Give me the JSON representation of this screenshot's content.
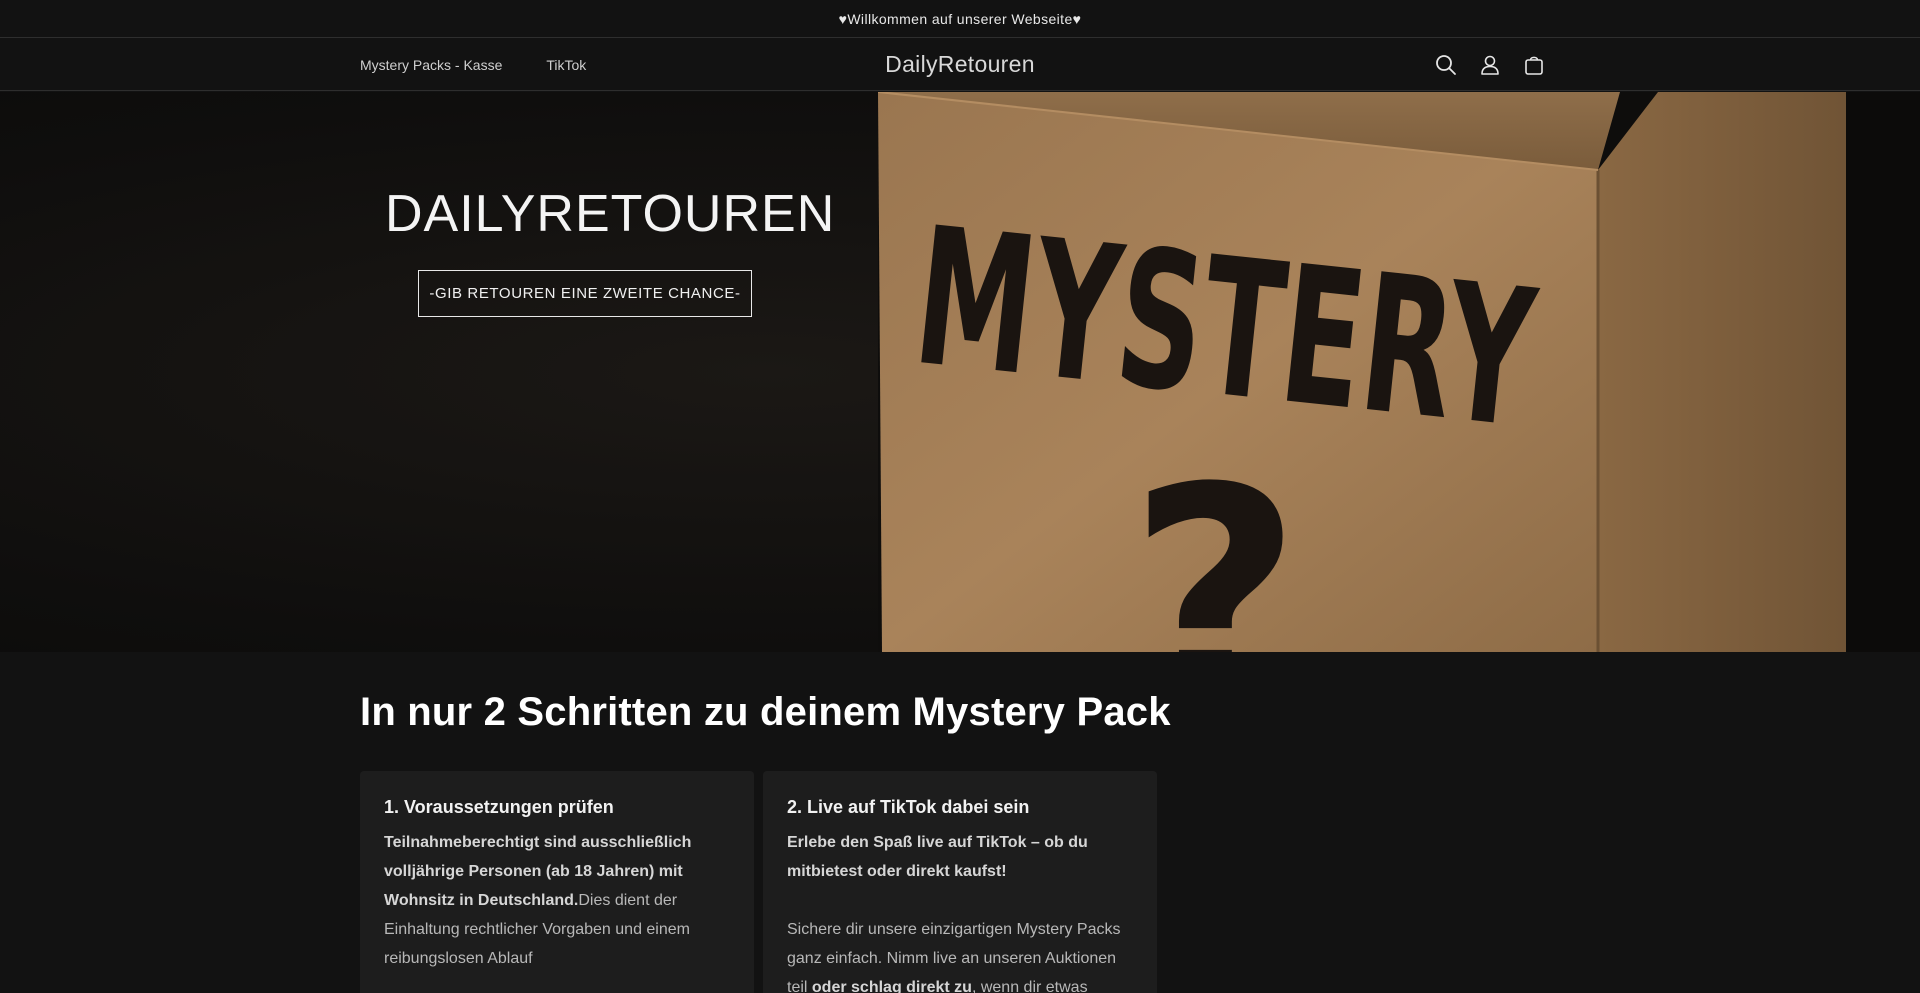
{
  "announcement": {
    "text": "♥Willkommen auf unserer Webseite♥"
  },
  "header": {
    "nav": [
      {
        "label": "Mystery Packs - Kasse"
      },
      {
        "label": "TikTok"
      }
    ],
    "logo": "DailyRetouren",
    "icons": [
      "search-icon",
      "account-icon",
      "cart-icon"
    ]
  },
  "hero": {
    "title": "DAILYRETOUREN",
    "button": "-GIB RETOUREN EINE ZWEITE CHANCE-",
    "image_text": "MYSTERY ?"
  },
  "steps": {
    "title": "In nur 2 Schritten zu deinem Mystery Pack",
    "cards": [
      {
        "heading": "1. Voraussetzungen prüfen",
        "bold": "Teilnahmeberechtigt sind ausschließlich volljährige Personen (ab 18 Jahren) mit Wohnsitz in Deutschland.",
        "rest": "Dies dient der Einhaltung rechtlicher Vorgaben und einem reibungslosen Ablauf"
      },
      {
        "heading": "2. Live auf TikTok dabei sein",
        "bold": "Erlebe den Spaß live auf TikTok – ob du mitbietest oder direkt kaufst!",
        "rest_a": "Sichere dir unsere einzigartigen Mystery Packs ganz einfach. Nimm live an unseren Auktionen teil ",
        "rest_b": "oder schlag direkt zu",
        "rest_c": ", wenn dir etwas"
      }
    ]
  },
  "colors": {
    "background": "#121212",
    "card": "#1d1d1d",
    "cardboard": "#a07a4e"
  }
}
